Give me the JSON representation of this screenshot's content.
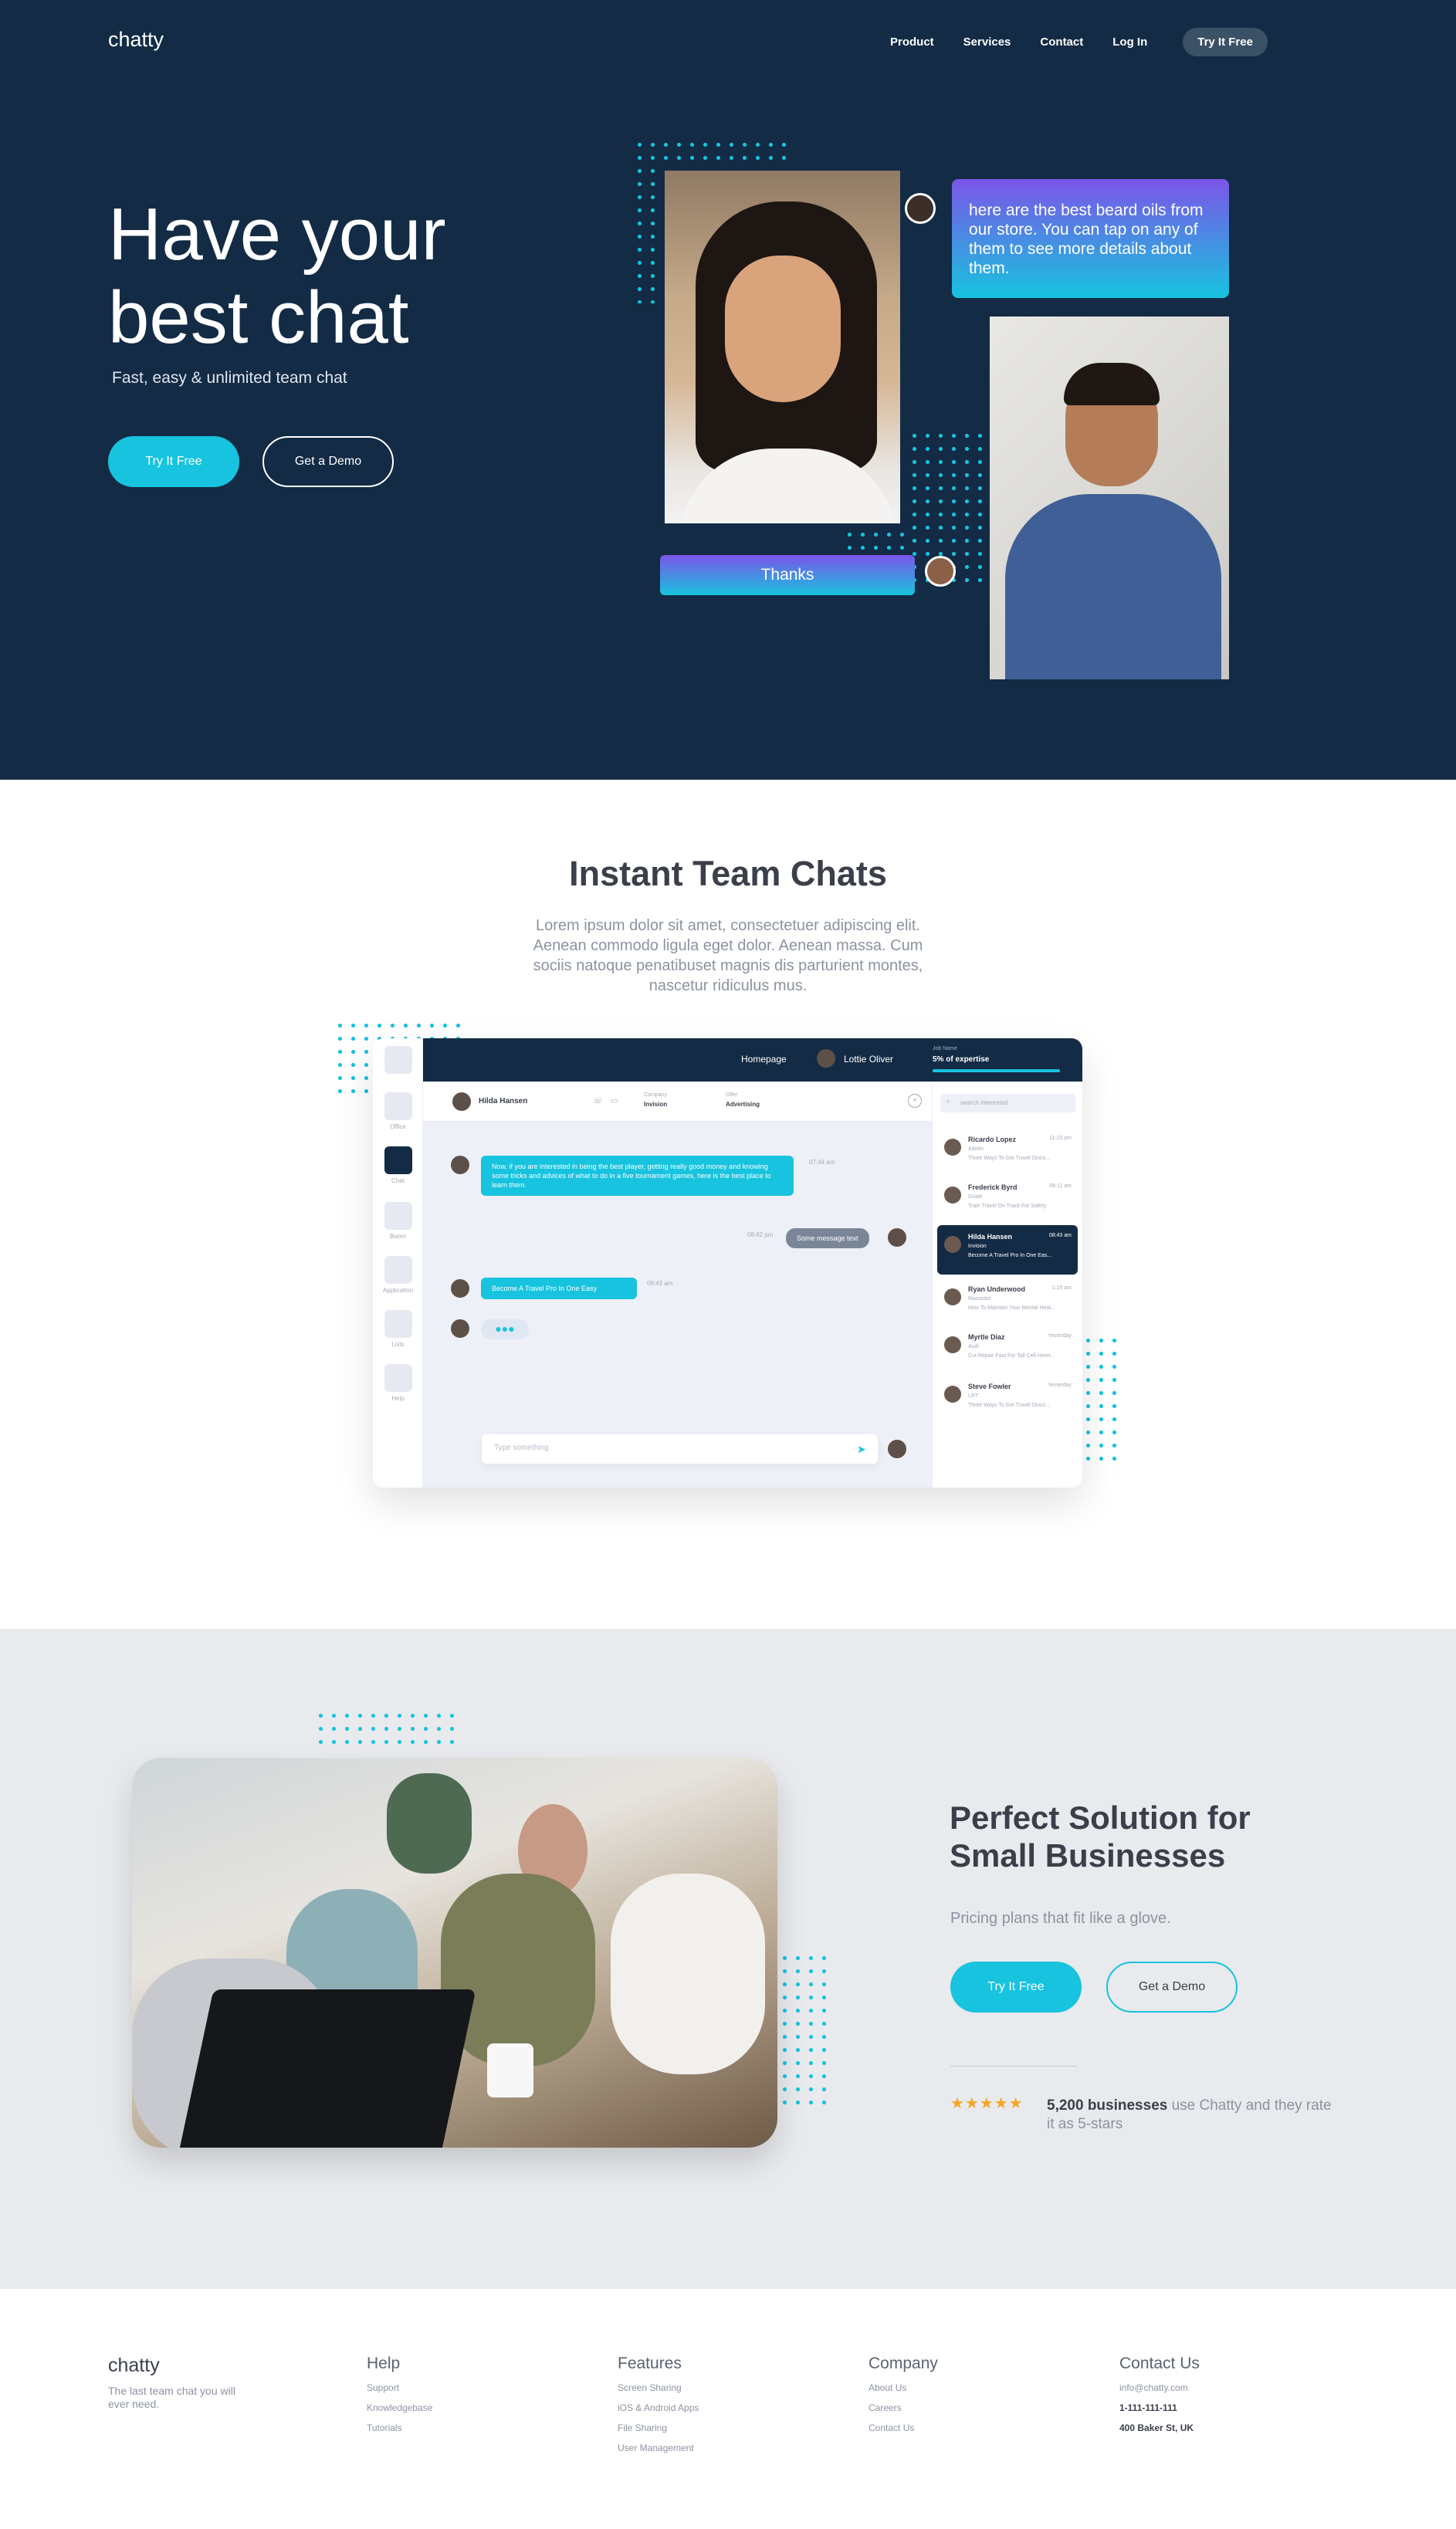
{
  "nav": {
    "logo": "chatty",
    "links": [
      "Product",
      "Services",
      "Contact",
      "Log In"
    ],
    "cta": "Try It Free"
  },
  "hero": {
    "title": "Have your best chat",
    "subtitle": "Fast, easy & unlimited team chat",
    "primary_button": "Try It Free",
    "secondary_button": "Get a Demo",
    "chat_bubble": "here are the best beard oils from our store. You can tap on any of them to see more details about them.",
    "reply_bubble": "Thanks"
  },
  "instant": {
    "title": "Instant Team Chats",
    "text": "Lorem ipsum dolor sit amet, consectetuer adipiscing elit. Aenean commodo ligula eget dolor. Aenean massa. Cum sociis natoque penatibuset magnis dis parturient montes, nascetur ridiculus mus."
  },
  "mock": {
    "rail": [
      "Office",
      "Chat",
      "Boom",
      "Application",
      "Lists",
      "Help"
    ],
    "top_link": "Homepage",
    "top_user": "Lottie Oliver",
    "job_label": "Job Name",
    "job_value": "5% of expertise",
    "chat_name": "Hilda Hansen",
    "company_label": "Company",
    "company_value": "Invision",
    "offer_label": "Offer",
    "offer_value": "Advertising",
    "msg1": "Now, if you are interested in being the best player, getting really good money and knowing some tricks and advices of what to do in a five tournament games, here is the best place to learn them.",
    "msg1_time": "07:44 am",
    "msg2": "Some message text",
    "msg2_time": "08:42 pm",
    "msg3": "Become A Travel Pro In One Easy",
    "msg3_time": "08:43 am",
    "type_placeholder": "Type something",
    "search_placeholder": "search interested",
    "contacts": [
      {
        "name": "Ricardo Lopez",
        "sub": "Admin",
        "msg": "Three Ways To Get Travel Disco...",
        "time": "11:23 pm"
      },
      {
        "name": "Frederick Byrd",
        "sub": "Guide",
        "msg": "Train Travel On Track For Safety",
        "time": "06:11 am"
      },
      {
        "name": "Hilda Hansen",
        "sub": "Invision",
        "msg": "Become A Travel Pro In One Eas...",
        "time": "08:43 am"
      },
      {
        "name": "Ryan Underwood",
        "sub": "Macrodor",
        "msg": "How To Maintain Your Mental Heal...",
        "time": "1:15 am"
      },
      {
        "name": "Myrtle Diaz",
        "sub": "Audi",
        "msg": "Cut Repair Fast For Tall Cell Herer...",
        "time": "Yesterday"
      },
      {
        "name": "Steve Fowler",
        "sub": "LRT",
        "msg": "Three Ways To Get Travel Disco...",
        "time": "Yesterday"
      }
    ]
  },
  "solution": {
    "title": "Perfect Solution for Small Businesses",
    "subtitle": "Pricing plans that fit like a glove.",
    "primary_button": "Try It Free",
    "secondary_button": "Get a Demo",
    "stars": "★★★★★",
    "rating_bold": "5,200 businesses",
    "rating_text": " use Chatty and they rate it as 5-stars"
  },
  "footer": {
    "logo": "chatty",
    "tagline": "The last team chat you will ever need.",
    "help": {
      "title": "Help",
      "links": [
        "Support",
        "Knowledgebase",
        "Tutorials"
      ]
    },
    "features": {
      "title": "Features",
      "links": [
        "Screen Sharing",
        "iOS & Android Apps",
        "File Sharing",
        "User Management"
      ]
    },
    "company": {
      "title": "Company",
      "links": [
        "About Us",
        "Careers",
        "Contact Us"
      ]
    },
    "contact": {
      "title": "Contact Us",
      "email": "info@chatty.com",
      "phone": "1-111-111-111",
      "address": "400 Baker St, UK"
    }
  },
  "colors": {
    "navy": "#132b45",
    "accent": "#17c3de",
    "purple": "#7b55e8",
    "star": "#f5a623"
  }
}
